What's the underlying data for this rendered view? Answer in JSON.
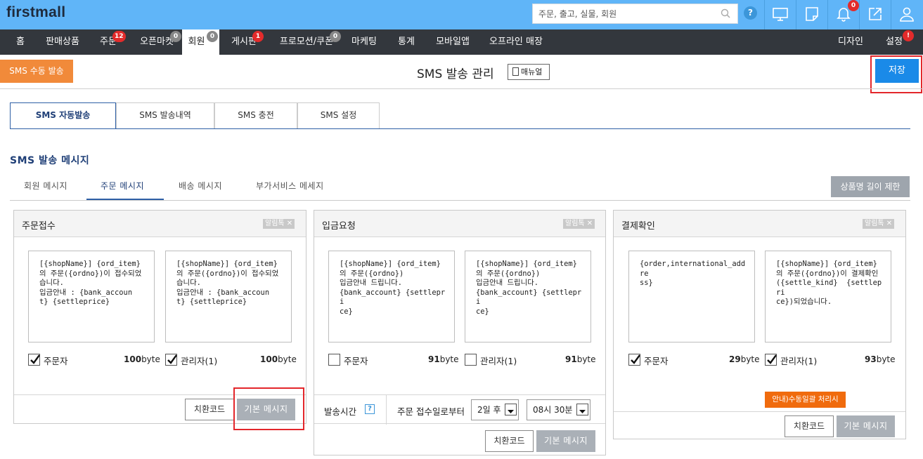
{
  "app": {
    "logo": "firstmall"
  },
  "search": {
    "placeholder": "주문, 출고, 실물, 회원"
  },
  "topbar": {
    "help": "?",
    "notification_count": "0"
  },
  "nav": {
    "items": [
      {
        "label": "홈"
      },
      {
        "label": "판매상품"
      },
      {
        "label": "주문",
        "badge": "12"
      },
      {
        "label": "오픈마켓",
        "badge": "0"
      },
      {
        "label": "회원",
        "badge": "0"
      },
      {
        "label": "게시판",
        "badge": "1"
      },
      {
        "label": "프로모션/쿠폰",
        "badge": "0"
      },
      {
        "label": "마케팅"
      },
      {
        "label": "통계"
      },
      {
        "label": "모바일앱"
      },
      {
        "label": "오프라인 매장"
      }
    ],
    "right": [
      {
        "label": "디자인"
      },
      {
        "label": "설정",
        "badge": "!"
      }
    ],
    "active": "회원"
  },
  "header": {
    "sms_manual": "SMS 수동 발송",
    "title": "SMS 발송 관리",
    "manual": "매뉴얼",
    "save": "저장"
  },
  "main_tabs": [
    {
      "label": "SMS 자동발송",
      "active": true
    },
    {
      "label": "SMS 발송내역"
    },
    {
      "label": "SMS 충전"
    },
    {
      "label": "SMS 설정"
    }
  ],
  "section": {
    "title": "SMS 발송 메시지",
    "limit_button": "상품명 길이 제한"
  },
  "sub_tabs": [
    {
      "label": "회원 메시지"
    },
    {
      "label": "주문 메시지",
      "active": true
    },
    {
      "label": "배송 메시지"
    },
    {
      "label": "부가서비스 메세지"
    }
  ],
  "panels": [
    {
      "title": "주문접수",
      "alimtalk": "알림톡 ✕",
      "messages": [
        {
          "text": "[{shopName}] {ord_item}\n의 주문({ordno})이 접수되었\n습니다.\n입금안내 : {bank_accoun\nt} {settleprice}",
          "label": "주문자",
          "checked": true,
          "bytes": "100",
          "unit": "byte"
        },
        {
          "text": "[{shopName}] {ord_item}\n의 주문({ordno})이 접수되었\n습니다.\n입금안내 : {bank_accoun\nt} {settleprice}",
          "label": "관리자(1)",
          "checked": true,
          "bytes": "100",
          "unit": "byte"
        }
      ],
      "btn_code": "치환코드",
      "btn_default": "기본 메시지"
    },
    {
      "title": "입금요청",
      "alimtalk": "알림톡 ✕",
      "messages": [
        {
          "text": "[{shopName}] {ord_item}\n의 주문({ordno})\n입금안내 드립니다.\n{bank_account} {settlepri\nce}",
          "label": "주문자",
          "checked": false,
          "bytes": "91",
          "unit": "byte"
        },
        {
          "text": "[{shopName}] {ord_item}\n의 주문({ordno})\n입금안내 드립니다.\n{bank_account} {settlepri\nce}",
          "label": "관리자(1)",
          "checked": false,
          "bytes": "91",
          "unit": "byte"
        }
      ],
      "send_time": {
        "label": "발송시간",
        "help": "?",
        "from": "주문 접수일로부터",
        "days": "2일 후",
        "time": "08시 30분"
      },
      "btn_code": "치환코드",
      "btn_default": "기본 메시지"
    },
    {
      "title": "결제확인",
      "alimtalk": "알림톡 ✕",
      "messages": [
        {
          "text": "{order,international_addre\nss}",
          "label": "주문자",
          "checked": true,
          "bytes": "29",
          "unit": "byte"
        },
        {
          "text": "[{shopName}] {ord_item}\n의 주문({ordno})이 결제확인\n({settle_kind}  {settlepri\nce})되었습니다.",
          "label": "관리자(1)",
          "checked": true,
          "bytes": "93",
          "unit": "byte"
        }
      ],
      "orange_button": "안내)수동일괄 처리시",
      "btn_code": "치환코드",
      "btn_default": "기본 메시지"
    }
  ],
  "colors": {
    "topbar": "#60b5f8",
    "nav": "#33373d",
    "save": "#1a8ae8",
    "sms_manual": "#f18a3a",
    "accent": "#2e5fa6",
    "badge": "#e32b2b"
  }
}
